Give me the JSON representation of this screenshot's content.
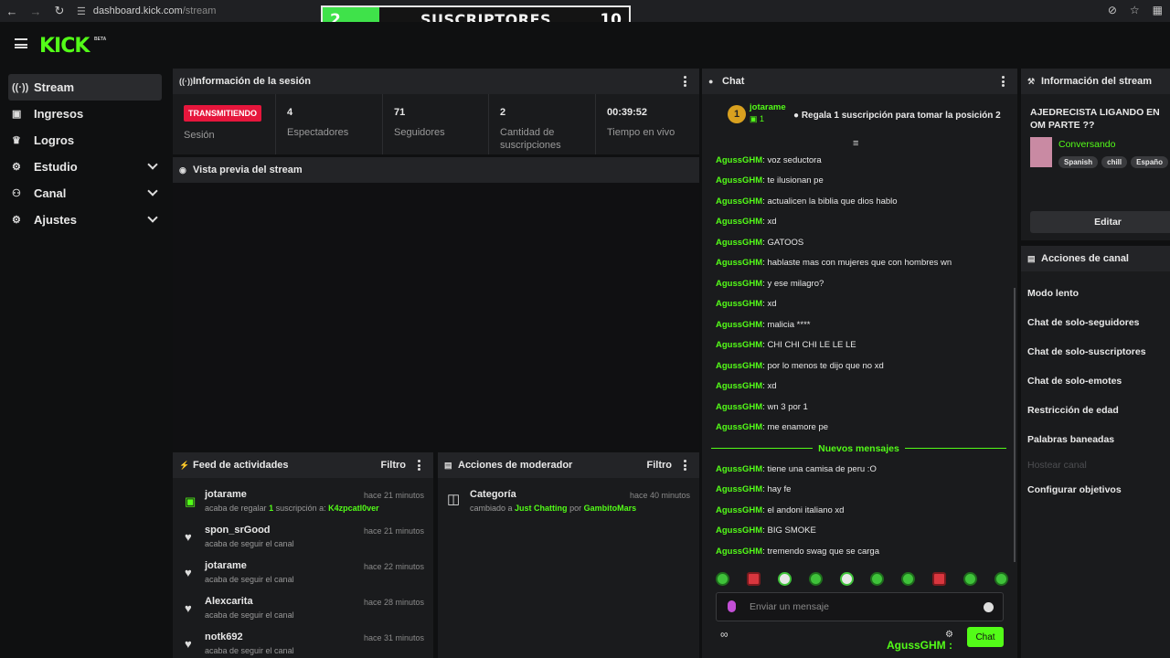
{
  "browser": {
    "url_host": "dashboard.kick.com",
    "url_path": "/stream"
  },
  "overlay": {
    "current": "2",
    "title": "SUSCRIPTORES",
    "goal": "10",
    "progress_fraction": 0.2
  },
  "brand": {
    "logo": "KICK",
    "beta": "BETA",
    "accent": "#53fc18"
  },
  "sidebar": {
    "items": [
      {
        "label": "Stream",
        "icon": "broadcast-icon"
      },
      {
        "label": "Ingresos",
        "icon": "chart-icon"
      },
      {
        "label": "Logros",
        "icon": "trophy-icon"
      },
      {
        "label": "Estudio",
        "icon": "sliders-icon"
      },
      {
        "label": "Canal",
        "icon": "users-icon"
      },
      {
        "label": "Ajustes",
        "icon": "gear-icon"
      }
    ]
  },
  "session": {
    "title": "Información de la sesión",
    "live_badge": "TRANSMITIENDO",
    "live_label": "Sesión",
    "stats": [
      {
        "value": "4",
        "label": "Espectadores"
      },
      {
        "value": "71",
        "label": "Seguidores"
      },
      {
        "value": "2",
        "label": "Cantidad de suscripciones"
      },
      {
        "value": "00:39:52",
        "label": "Tiempo en vivo"
      }
    ]
  },
  "preview": {
    "title": "Vista previa del stream"
  },
  "feed": {
    "title": "Feed de actividades",
    "filter": "Filtro",
    "items": [
      {
        "name": "jotarame",
        "pre": "acaba de regalar",
        "count": "1",
        "mid": "suscripción a:",
        "target": "K4zpcatl0ver",
        "time": "hace 21 minutos"
      },
      {
        "name": "spon_srGood",
        "desc": "acaba de seguir el canal",
        "time": "hace 21 minutos"
      },
      {
        "name": "jotarame",
        "desc": "acaba de seguir el canal",
        "time": "hace 22 minutos"
      },
      {
        "name": "Alexcarita",
        "desc": "acaba de seguir el canal",
        "time": "hace 28 minutos"
      },
      {
        "name": "notk692",
        "desc": "acaba de seguir el canal",
        "time": "hace 31 minutos"
      }
    ]
  },
  "mod": {
    "title": "Acciones de moderador",
    "filter": "Filtro",
    "item": {
      "title": "Categoría",
      "pre": "cambiado a",
      "category": "Just Chatting",
      "by": "por",
      "user": "GambitoMars",
      "time": "hace 40 minutos"
    }
  },
  "chat": {
    "title": "Chat",
    "top_user": "jotarame",
    "top_rank": "1",
    "top_subs": "1",
    "top_message": "Regala 1 suscripción para tomar la posición 2",
    "messages_before": [
      {
        "user": "AgussGHM",
        "text": "voz seductora"
      },
      {
        "user": "AgussGHM",
        "text": "te ilusionan pe"
      },
      {
        "user": "AgussGHM",
        "text": "actualicen la biblia que dios hablo"
      },
      {
        "user": "AgussGHM",
        "text": "xd"
      },
      {
        "user": "AgussGHM",
        "text": "GATOOS"
      },
      {
        "user": "AgussGHM",
        "text": "hablaste mas con mujeres que con hombres wn"
      },
      {
        "user": "AgussGHM",
        "text": "y ese milagro?"
      },
      {
        "user": "AgussGHM",
        "text": "xd"
      },
      {
        "user": "AgussGHM",
        "text": "malicia ****"
      },
      {
        "user": "AgussGHM",
        "text": "CHI CHI CHI LE LE LE"
      },
      {
        "user": "AgussGHM",
        "text": "por lo menos te dijo que no xd"
      },
      {
        "user": "AgussGHM",
        "text": "xd"
      },
      {
        "user": "AgussGHM",
        "text": "wn 3 por 1"
      },
      {
        "user": "AgussGHM",
        "text": "me enamore pe"
      }
    ],
    "new_messages_label": "Nuevos mensajes",
    "messages_after": [
      {
        "user": "AgussGHM",
        "text": "tiene una camisa de peru :O"
      },
      {
        "user": "AgussGHM",
        "text": "hay fe"
      },
      {
        "user": "AgussGHM",
        "text": "el andoni italiano xd"
      },
      {
        "user": "AgussGHM",
        "text": "BIG SMOKE"
      },
      {
        "user": "AgussGHM",
        "text": "tremendo swag que se carga"
      }
    ],
    "input_placeholder": "Enviar un mensaje",
    "send_label": "Chat",
    "footer_user": "AgussGHM :"
  },
  "stream_info": {
    "title": "Información del stream",
    "stream_title": "AJEDRECISTA LIGANDO EN OM PARTE ??",
    "category": "Conversando",
    "tags": [
      "Spanish",
      "chill",
      "Españo"
    ],
    "edit_label": "Editar"
  },
  "channel_actions": {
    "title": "Acciones de canal",
    "items": [
      "Modo lento",
      "Chat de solo-seguidores",
      "Chat de solo-suscriptores",
      "Chat de solo-emotes",
      "Restricción de edad",
      "Palabras baneadas",
      "Hostear canal",
      "Configurar objetivos"
    ]
  }
}
